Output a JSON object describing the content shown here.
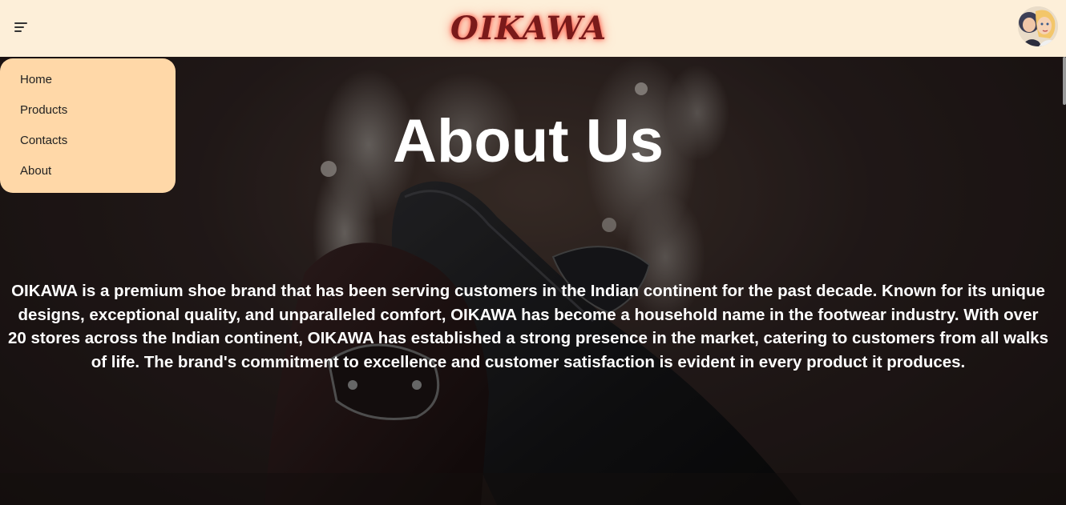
{
  "header": {
    "logo_text": "OIKAWA",
    "menu_icon": "hamburger-menu-icon",
    "avatar": "user-avatar"
  },
  "side_menu": {
    "items": [
      {
        "label": "Home"
      },
      {
        "label": "Products"
      },
      {
        "label": "Contacts"
      },
      {
        "label": "About"
      }
    ]
  },
  "hero": {
    "title": "About Us",
    "description": "OIKAWA is a premium shoe brand that has been serving customers in the Indian continent for the past decade. Known for its unique designs, exceptional quality, and unparalleled comfort, OIKAWA has become a household name in the footwear industry. With over 20 stores across the Indian continent, OIKAWA has established a strong presence in the market, catering to customers from all walks of life. The brand's commitment to excellence and customer satisfaction is evident in every product it produces.",
    "background_image": "black-leather-loafer-shoes"
  },
  "colors": {
    "header_bg": "#fdefd9",
    "menu_bg": "#ffd8a8",
    "logo": "#7a1a1a",
    "logo_glow": "#ff4a3a",
    "text_on_hero": "#ffffff"
  }
}
